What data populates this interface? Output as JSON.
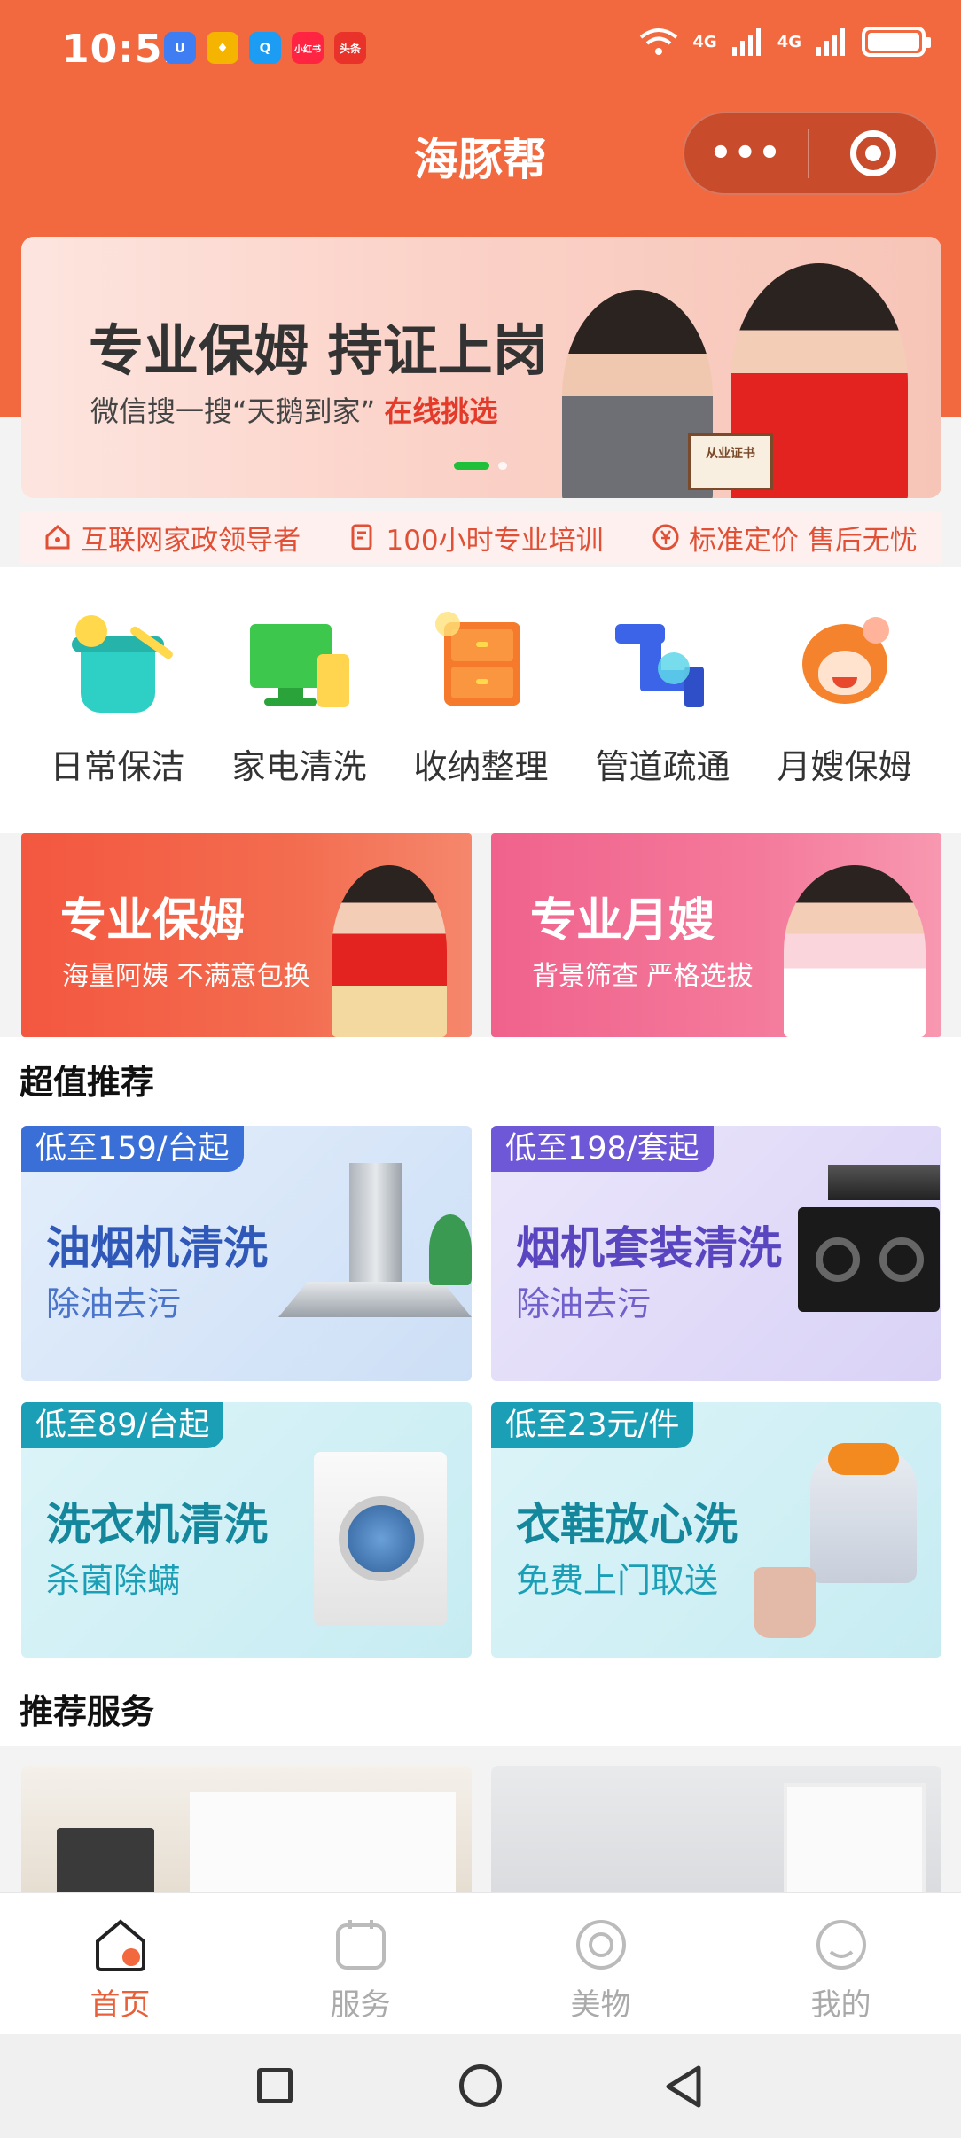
{
  "status_bar": {
    "time": "10:52",
    "net1": "4G",
    "net2": "4G",
    "apps": [
      "U",
      "♦",
      "Q",
      "小红书",
      "头条"
    ]
  },
  "header": {
    "title": "海豚帮",
    "more": "•••"
  },
  "banner": {
    "title": "专业保姆 持证上岗",
    "subtitle_prefix": "微信搜一搜“天鹅到家”",
    "subtitle_highlight": "在线挑选",
    "certificate": "从业证书"
  },
  "features": [
    "互联网家政领导者",
    "100小时专业培训",
    "标准定价 售后无忧"
  ],
  "categories": [
    "日常保洁",
    "家电清洗",
    "收纳整理",
    "管道疏通",
    "月嫂保姆"
  ],
  "promos": [
    {
      "title": "专业保姆",
      "subtitle": "海量阿姨 不满意包换"
    },
    {
      "title": "专业月嫂",
      "subtitle": "背景筛查 严格选拔"
    }
  ],
  "sections": {
    "deals_title": "超值推荐",
    "recommend_title": "推荐服务"
  },
  "deals": [
    {
      "tag": "低至159/台起",
      "title": "油烟机清洗",
      "subtitle": "除油去污"
    },
    {
      "tag": "低至198/套起",
      "title": "烟机套装清洗",
      "subtitle": "除油去污"
    },
    {
      "tag": "低至89/台起",
      "title": "洗衣机清洗",
      "subtitle": "杀菌除螨"
    },
    {
      "tag": "低至23元/件",
      "title": "衣鞋放心洗",
      "subtitle": "免费上门取送"
    }
  ],
  "tabs": [
    "首页",
    "服务",
    "美物",
    "我的"
  ],
  "colors": {
    "brand": "#f2683f",
    "tab_active": "#e8603a",
    "promo_red": "#f0573f",
    "promo_pink": "#f26893"
  }
}
